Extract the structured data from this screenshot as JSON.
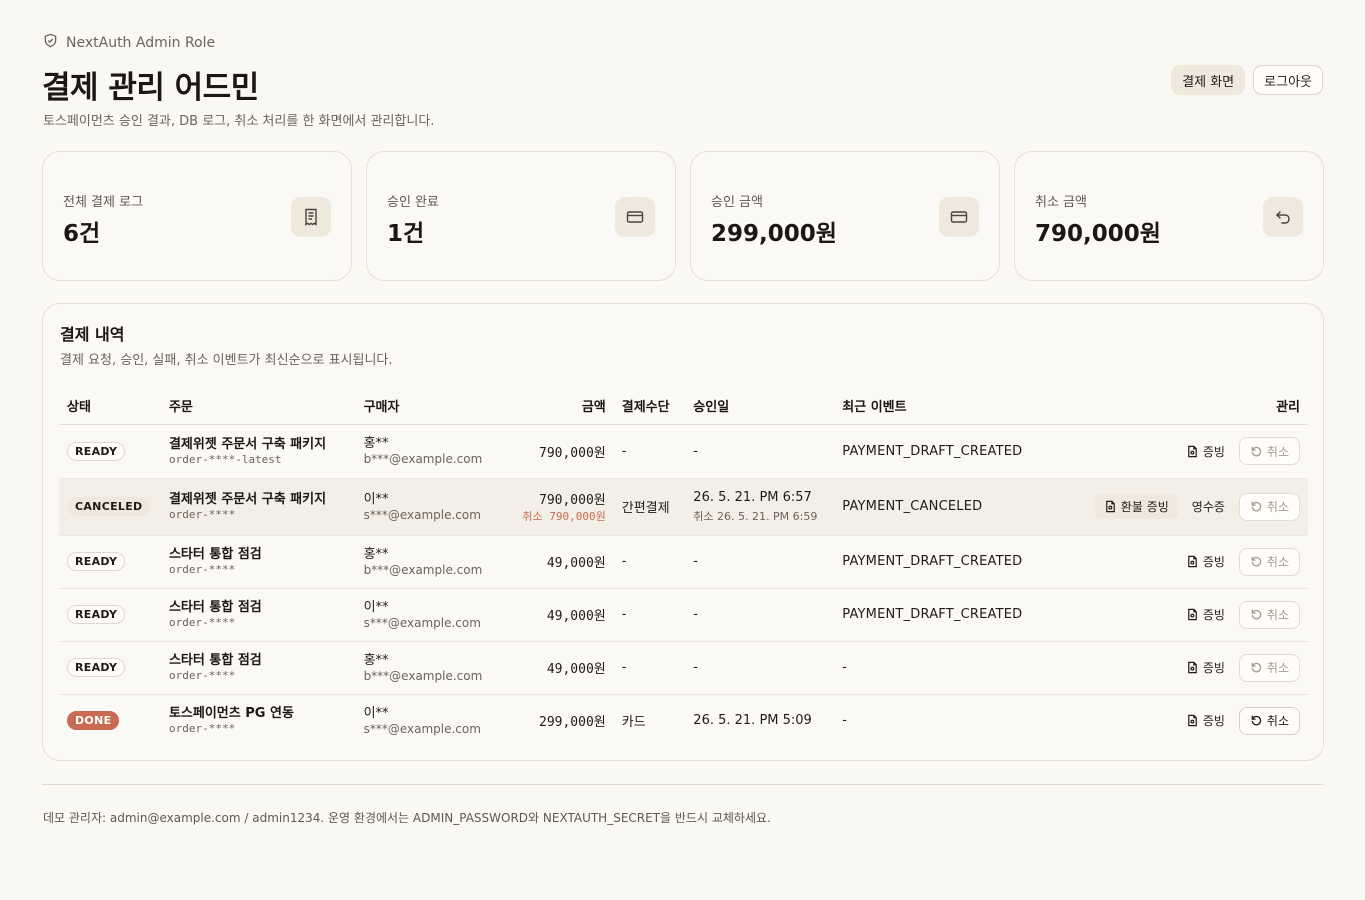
{
  "header": {
    "eyebrow": "NextAuth Admin Role",
    "title": "결제 관리 어드민",
    "subtitle": "토스페이먼츠 승인 결과, DB 로그, 취소 처리를 한 화면에서 관리합니다.",
    "payment_screen_label": "결제 화면",
    "logout_label": "로그아웃"
  },
  "stats": [
    {
      "label": "전체 결제 로그",
      "value": "6건",
      "icon": "receipt-icon"
    },
    {
      "label": "승인 완료",
      "value": "1건",
      "icon": "credit-card-icon"
    },
    {
      "label": "승인 금액",
      "value": "299,000원",
      "icon": "credit-card-icon"
    },
    {
      "label": "취소 금액",
      "value": "790,000원",
      "icon": "undo-icon"
    }
  ],
  "panel": {
    "title": "결제 내역",
    "subtitle": "결제 요청, 승인, 실패, 취소 이벤트가 최신순으로 표시됩니다.",
    "columns": {
      "status": "상태",
      "order": "주문",
      "buyer": "구매자",
      "amount": "금액",
      "method": "결제수단",
      "approved_at": "승인일",
      "event": "최근 이벤트",
      "manage": "관리"
    },
    "rows": [
      {
        "status": "READY",
        "order_name": "결제위젯 주문서 구축 패키지",
        "order_id": "order-****-latest",
        "buyer_name": "홍**",
        "buyer_email": "b***@example.com",
        "amount": "790,000원",
        "amount_cancel": "",
        "method": "-",
        "approved_at": "-",
        "approved_sub": "",
        "event": "PAYMENT_DRAFT_CREATED",
        "proof_label": "증빙",
        "receipt_label": "",
        "cancel_label": "취소"
      },
      {
        "status": "CANCELED",
        "order_name": "결제위젯 주문서 구축 패키지",
        "order_id": "order-****",
        "buyer_name": "이**",
        "buyer_email": "s***@example.com",
        "amount": "790,000원",
        "amount_cancel": "취소 790,000원",
        "method": "간편결제",
        "approved_at": "26. 5. 21. PM 6:57",
        "approved_sub": "취소 26. 5. 21. PM 6:59",
        "event": "PAYMENT_CANCELED",
        "proof_label": "환불 증빙",
        "receipt_label": "영수증",
        "cancel_label": "취소"
      },
      {
        "status": "READY",
        "order_name": "스타터 통합 점검",
        "order_id": "order-****",
        "buyer_name": "홍**",
        "buyer_email": "b***@example.com",
        "amount": "49,000원",
        "amount_cancel": "",
        "method": "-",
        "approved_at": "-",
        "approved_sub": "",
        "event": "PAYMENT_DRAFT_CREATED",
        "proof_label": "증빙",
        "receipt_label": "",
        "cancel_label": "취소"
      },
      {
        "status": "READY",
        "order_name": "스타터 통합 점검",
        "order_id": "order-****",
        "buyer_name": "이**",
        "buyer_email": "s***@example.com",
        "amount": "49,000원",
        "amount_cancel": "",
        "method": "-",
        "approved_at": "-",
        "approved_sub": "",
        "event": "PAYMENT_DRAFT_CREATED",
        "proof_label": "증빙",
        "receipt_label": "",
        "cancel_label": "취소"
      },
      {
        "status": "READY",
        "order_name": "스타터 통합 점검",
        "order_id": "order-****",
        "buyer_name": "홍**",
        "buyer_email": "b***@example.com",
        "amount": "49,000원",
        "amount_cancel": "",
        "method": "-",
        "approved_at": "-",
        "approved_sub": "",
        "event": "-",
        "proof_label": "증빙",
        "receipt_label": "",
        "cancel_label": "취소"
      },
      {
        "status": "DONE",
        "order_name": "토스페이먼츠 PG 연동",
        "order_id": "order-****",
        "buyer_name": "이**",
        "buyer_email": "s***@example.com",
        "amount": "299,000원",
        "amount_cancel": "",
        "method": "카드",
        "approved_at": "26. 5. 21. PM 5:09",
        "approved_sub": "",
        "event": "-",
        "proof_label": "증빙",
        "receipt_label": "",
        "cancel_label": "취소"
      }
    ]
  },
  "footer": {
    "text": "데모 관리자: admin@example.com / admin1234. 운영 환경에서는 ADMIN_PASSWORD와 NEXTAUTH_SECRET을 반드시 교체하세요."
  },
  "colors": {
    "background": "#faf8f3",
    "accent": "#c96a52",
    "soft": "#efe8dc"
  }
}
